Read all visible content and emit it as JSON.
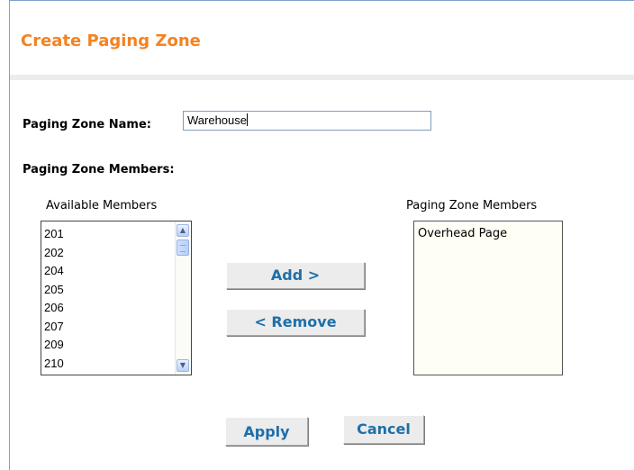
{
  "page": {
    "title": "Create Paging Zone"
  },
  "form": {
    "name_label": "Paging Zone Name:",
    "name_value": "Warehouse",
    "members_label": "Paging Zone Members:"
  },
  "available": {
    "caption": "Available Members",
    "items": [
      "201",
      "202",
      "204",
      "205",
      "206",
      "207",
      "209",
      "210"
    ]
  },
  "members": {
    "caption": "Paging Zone Members",
    "items": [
      "Overhead Page"
    ]
  },
  "buttons": {
    "add": "Add >",
    "remove": "< Remove",
    "apply": "Apply",
    "cancel": "Cancel"
  },
  "icons": {
    "scroll_up": "chevron-up-icon",
    "scroll_down": "chevron-down-icon"
  },
  "colors": {
    "title": "#f58220",
    "button_text": "#1e6fa9",
    "frame_border": "#7da2ce"
  }
}
